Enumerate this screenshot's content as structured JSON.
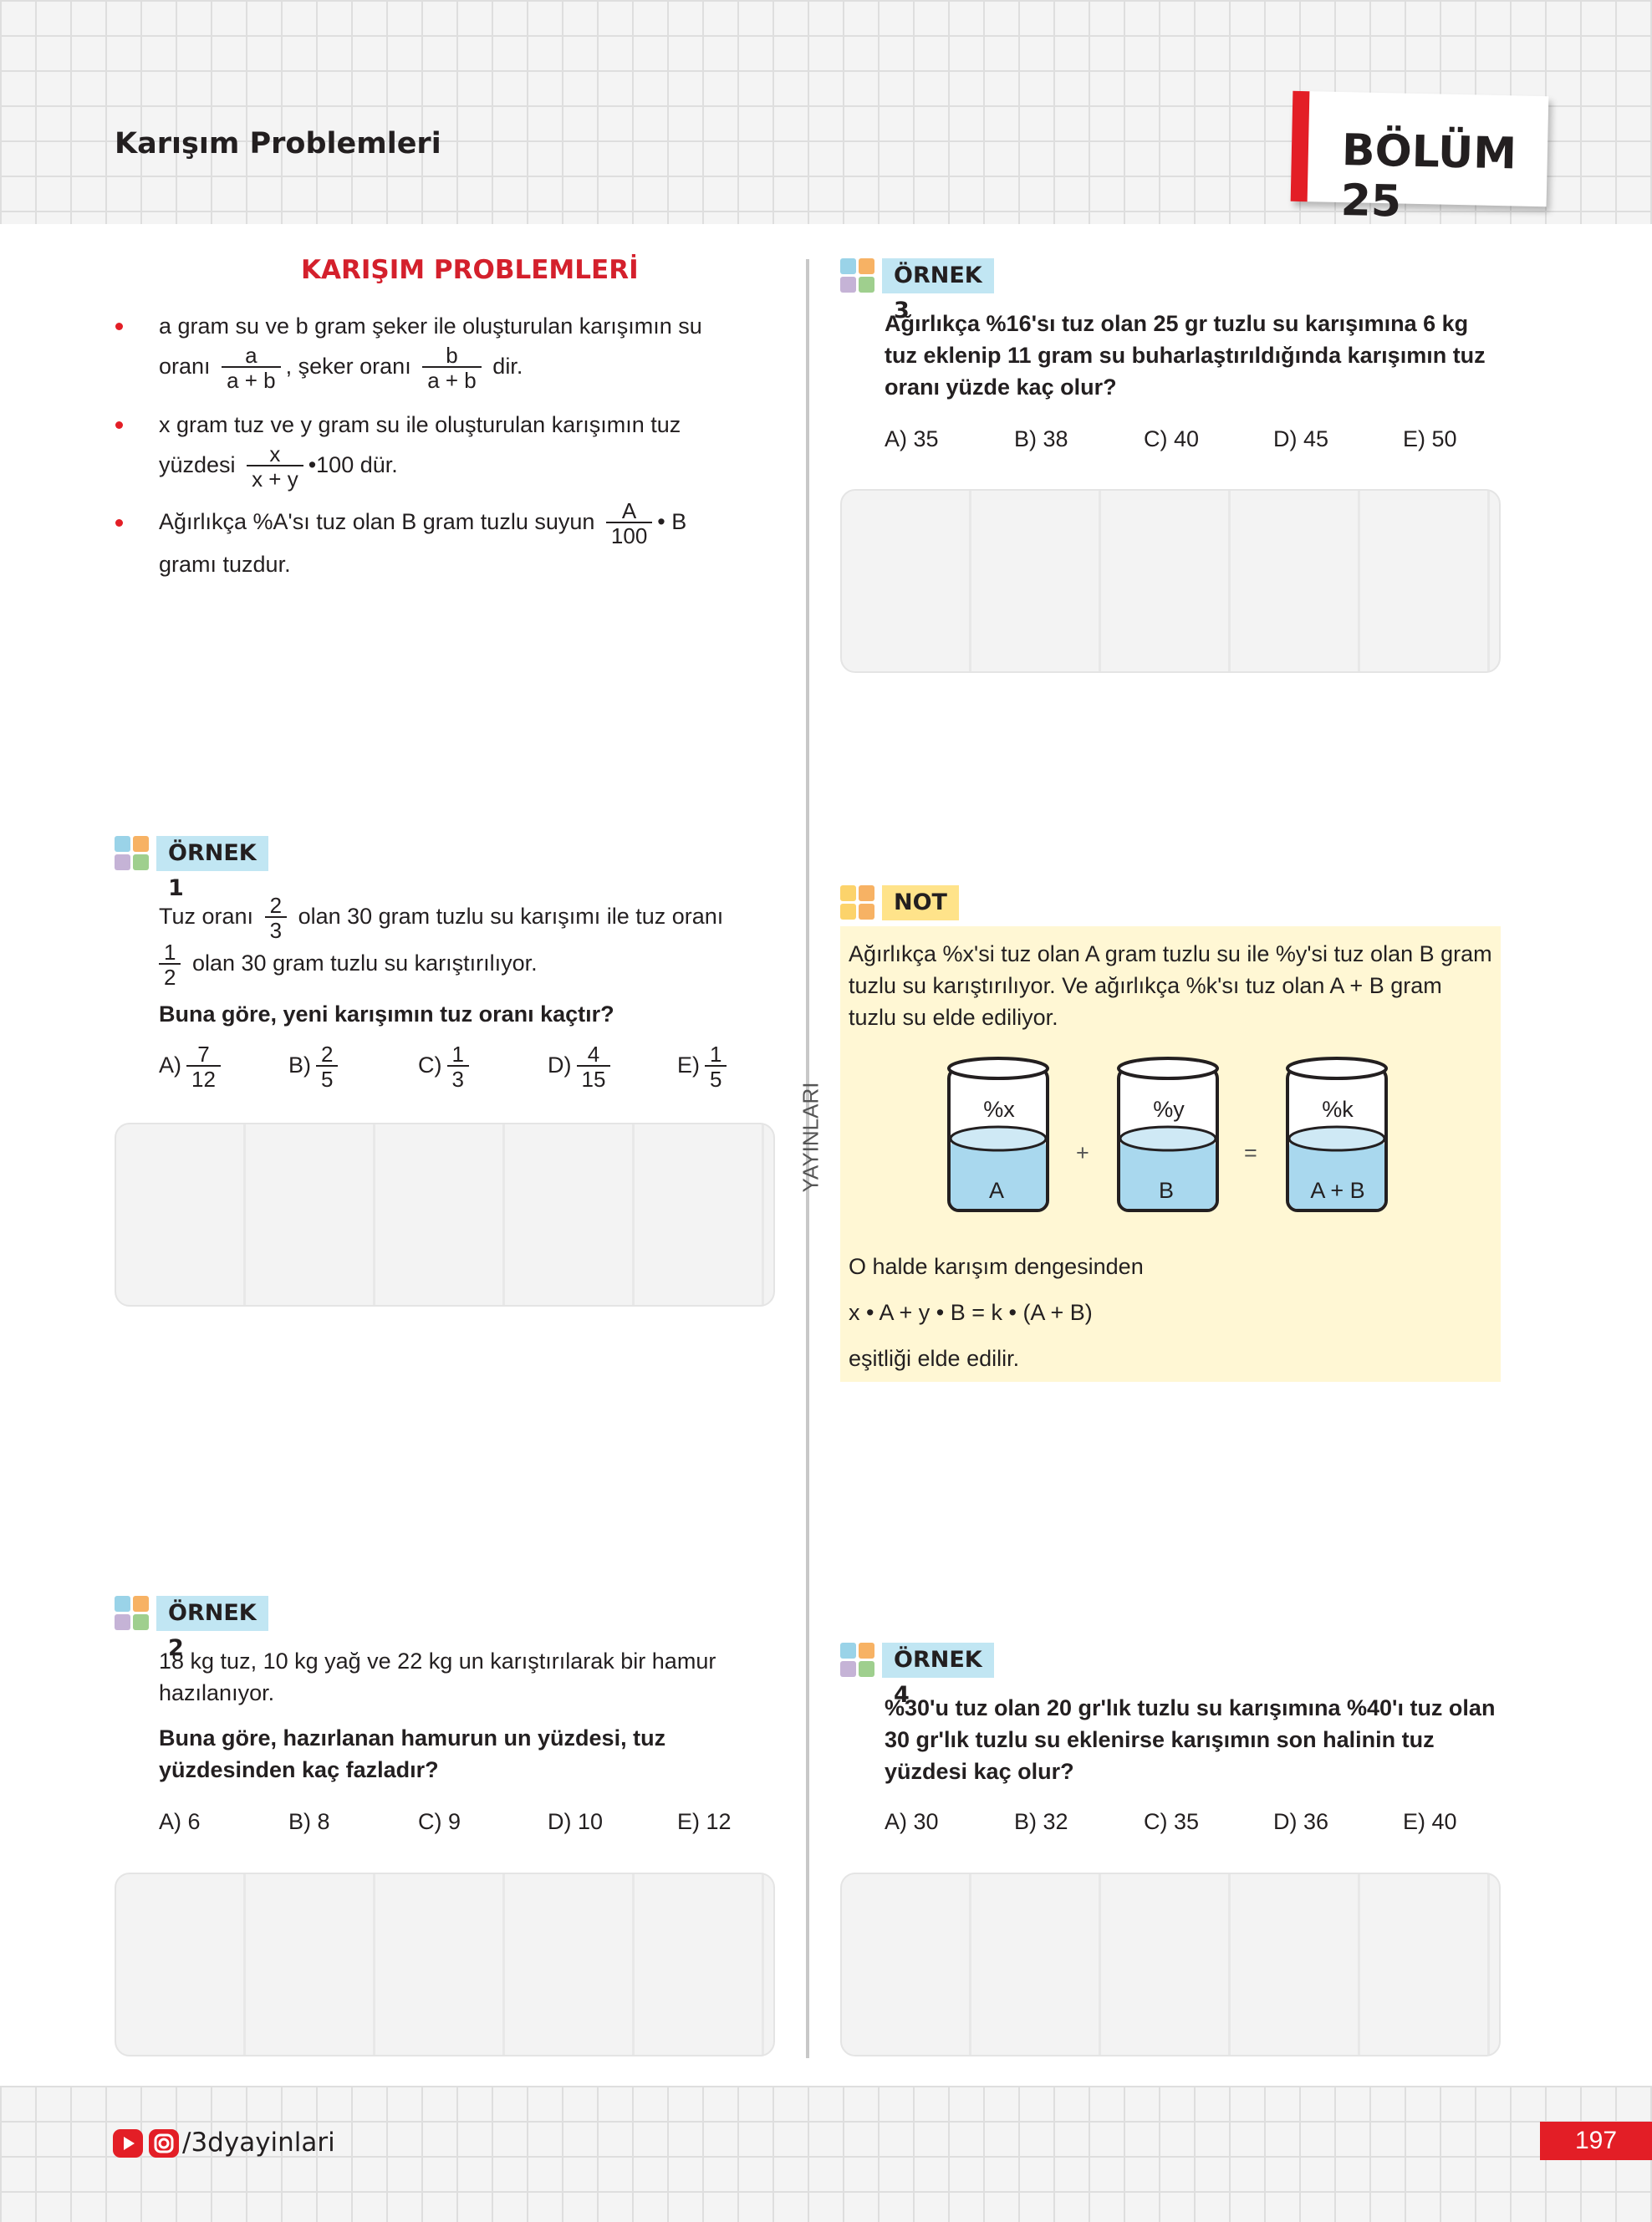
{
  "header": {
    "title": "Karışım Problemleri",
    "section": "BÖLÜM 25"
  },
  "theory": {
    "heading": "KARIŞIM PROBLEMLERİ",
    "b1_l1": "a gram su ve b gram şeker ile oluşturulan karışımın su",
    "b1_pre": "oranı",
    "b1_f1_n": "a",
    "b1_f1_d": "a + b",
    "b1_mid": ", şeker oranı",
    "b1_f2_n": "b",
    "b1_f2_d": "a + b",
    "b1_post": "dir.",
    "b2_l1": "x gram tuz ve y gram su ile oluşturulan karışımın tuz",
    "b2_pre": "yüzdesi",
    "b2_f_n": "x",
    "b2_f_d": "x + y",
    "b2_post": "•100  dür.",
    "b3_pre": "Ağırlıkça %A'sı tuz olan B gram tuzlu suyun",
    "b3_f_n": "A",
    "b3_f_d": "100",
    "b3_post": "• B",
    "b3_l2": "gramı tuzdur."
  },
  "ornek1": {
    "tag": "ÖRNEK 1",
    "l1_pre": "Tuz oranı",
    "f1_n": "2",
    "f1_d": "3",
    "l1_post": "olan 30 gram tuzlu su karışımı ile tuz oranı",
    "f2_n": "1",
    "f2_d": "2",
    "l2_post": "olan 30 gram tuzlu su karıştırılıyor.",
    "question": "Buna göre, yeni karışımın tuz oranı kaçtır?",
    "options": [
      {
        "l": "A)",
        "n": "7",
        "d": "12"
      },
      {
        "l": "B)",
        "n": "2",
        "d": "5"
      },
      {
        "l": "C)",
        "n": "1",
        "d": "3"
      },
      {
        "l": "D)",
        "n": "4",
        "d": "15"
      },
      {
        "l": "E)",
        "n": "1",
        "d": "5"
      }
    ]
  },
  "ornek2": {
    "tag": "ÖRNEK 2",
    "text": "18 kg tuz, 10 kg yağ ve 22 kg un karıştırılarak bir hamur hazılanıyor.",
    "question": "Buna göre, hazırlanan hamurun un yüzdesi, tuz yüzdesinden kaç fazladır?",
    "options": [
      "A) 6",
      "B) 8",
      "C) 9",
      "D) 10",
      "E) 12"
    ]
  },
  "ornek3": {
    "tag": "ÖRNEK 3",
    "question": "Ağırlıkça %16'sı tuz olan 25 gr tuzlu su karışımına 6 kg tuz eklenip 11 gram su buharlaştırıldığında karışımın tuz oranı yüzde kaç olur?",
    "options": [
      "A) 35",
      "B) 38",
      "C) 40",
      "D) 45",
      "E) 50"
    ]
  },
  "not": {
    "tag": "NOT",
    "text": "Ağırlıkça %x'si tuz olan A gram tuzlu su ile %y'si tuz olan B gram tuzlu su karıştırılıyor. Ve ağırlıkça %k'sı tuz olan A + B gram tuzlu su elde ediliyor.",
    "beakers": [
      {
        "top": "%x",
        "bottom": "A"
      },
      {
        "top": "%y",
        "bottom": "B"
      },
      {
        "top": "%k",
        "bottom": "A + B"
      }
    ],
    "plus": "+",
    "equals": "=",
    "line1": "O halde karışım dengesinden",
    "formula": "x • A + y • B = k • (A + B)",
    "line3": "eşitliği elde edilir."
  },
  "ornek4": {
    "tag": "ÖRNEK 4",
    "question": "%30'u tuz olan 20 gr'lık tuzlu su karışımına %40'ı tuz olan 30 gr'lık tuzlu su eklenirse karışımın son halinin tuz yüzdesi kaç olur?",
    "options": [
      "A) 30",
      "B) 32",
      "C) 35",
      "D) 36",
      "E) 40"
    ]
  },
  "side_label": "YAYINLARI",
  "footer": {
    "social": "/3dyayinlari",
    "page": "197"
  },
  "colors": {
    "accent": "#e31e26",
    "tag_blue": "#c1e6f3",
    "tag_yellow": "#ffe38a",
    "note_bg": "#fff7d4",
    "water": "#a9d8ee"
  }
}
